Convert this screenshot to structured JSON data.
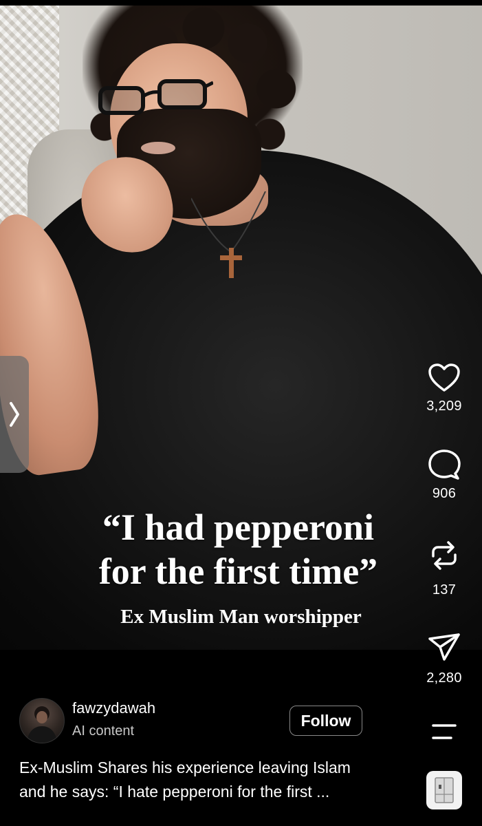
{
  "overlay": {
    "headline_line1": "“I had pepperoni",
    "headline_line2": "for the first time”",
    "subhead": "Ex Muslim Man worshipper"
  },
  "actions": {
    "like_count": "3,209",
    "comment_count": "906",
    "repost_count": "137",
    "share_count": "2,280"
  },
  "author": {
    "username": "fawzydawah",
    "label": "AI content",
    "follow_label": "Follow"
  },
  "caption": {
    "line1": "Ex-Muslim Shares his experience leaving Islam",
    "line2": "and he says: “I hate pepperoni for the first ..."
  },
  "icons": {
    "like": "heart-icon",
    "comment": "comment-icon",
    "repost": "repost-icon",
    "share": "send-icon",
    "more": "menu-icon",
    "side": "chevron-right-icon",
    "thumbnail": "fridge-icon"
  },
  "colors": {
    "background": "#000000",
    "text": "#ffffff",
    "secondary_text": "#c8c8c8",
    "follow_border": "#8a8a8a"
  }
}
